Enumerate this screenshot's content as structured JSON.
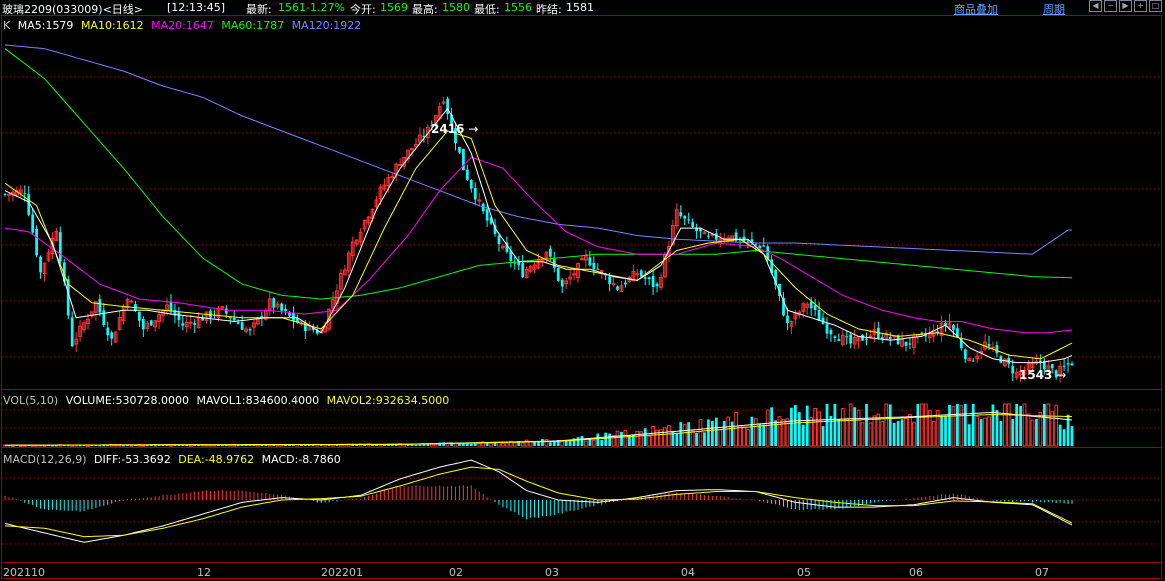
{
  "header": {
    "symbol": "玻璃2209(033009)<日线>",
    "time": "[12:13:45]",
    "latest_label": "最新:",
    "latest": "1561",
    "change": "-1.27%",
    "open_label": "今开:",
    "open": "1569",
    "high_label": "最高:",
    "high": "1580",
    "low_label": "最低:",
    "low": "1556",
    "prev_label": "昨结:",
    "prev": "1581",
    "overlay_btn": "商品叠加",
    "period_btn": "周期"
  },
  "ma_legend": {
    "k": "K",
    "ma5": "MA5:1579",
    "ma10": "MA10:1612",
    "ma20": "MA20:1647",
    "ma60": "MA60:1787",
    "ma120": "MA120:1922"
  },
  "vol_legend": {
    "title": "VOL(5,10)",
    "volume": "VOLUME:530728.0000",
    "mavol1": "MAVOL1:834600.4000",
    "mavol2": "MAVOL2:932634.5000"
  },
  "macd_legend": {
    "title": "MACD(12,26,9)",
    "diff": "DIFF:-53.3692",
    "dea": "DEA:-48.9762",
    "macd": "MACD:-8.7860"
  },
  "annotations": {
    "high_mark": "2416",
    "low_mark": "1543"
  },
  "x_axis": [
    "202110",
    "12",
    "202201",
    "02",
    "03",
    "04",
    "05",
    "06",
    "07"
  ],
  "colors": {
    "up": "#ff3232",
    "down": "#00ffff",
    "ma5": "#ffffff",
    "ma10": "#ffff00",
    "ma20": "#ff00ff",
    "ma60": "#00ff00",
    "ma120": "#8080ff",
    "grid": "#a00000"
  },
  "chart_data": {
    "type": "candlestick",
    "y_range": [
      1500,
      2450
    ],
    "series_keypoints": {
      "close": [
        [
          0,
          2010
        ],
        [
          5,
          2020
        ],
        [
          9,
          1800
        ],
        [
          13,
          1920
        ],
        [
          17,
          1610
        ],
        [
          23,
          1720
        ],
        [
          27,
          1620
        ],
        [
          31,
          1740
        ],
        [
          35,
          1650
        ],
        [
          41,
          1710
        ],
        [
          45,
          1660
        ],
        [
          55,
          1700
        ],
        [
          62,
          1640
        ],
        [
          67,
          1720
        ],
        [
          75,
          1660
        ],
        [
          80,
          1640
        ],
        [
          88,
          1880
        ],
        [
          95,
          2020
        ],
        [
          100,
          2100
        ],
        [
          107,
          2180
        ],
        [
          111,
          2270
        ],
        [
          116,
          2080
        ],
        [
          121,
          1960
        ],
        [
          126,
          1860
        ],
        [
          131,
          1800
        ],
        [
          137,
          1860
        ],
        [
          141,
          1760
        ],
        [
          147,
          1840
        ],
        [
          151,
          1800
        ],
        [
          155,
          1760
        ],
        [
          160,
          1800
        ],
        [
          165,
          1760
        ],
        [
          170,
          1960
        ],
        [
          174,
          1920
        ],
        [
          178,
          1890
        ],
        [
          183,
          1900
        ],
        [
          188,
          1880
        ],
        [
          192,
          1870
        ],
        [
          198,
          1660
        ],
        [
          203,
          1720
        ],
        [
          208,
          1650
        ],
        [
          214,
          1610
        ],
        [
          220,
          1640
        ],
        [
          228,
          1610
        ],
        [
          235,
          1640
        ],
        [
          239,
          1670
        ],
        [
          244,
          1560
        ],
        [
          248,
          1610
        ],
        [
          256,
          1530
        ],
        [
          262,
          1560
        ],
        [
          266,
          1530
        ],
        [
          270,
          1561
        ]
      ],
      "ma5": [
        [
          0,
          2020
        ],
        [
          6,
          1990
        ],
        [
          12,
          1880
        ],
        [
          18,
          1680
        ],
        [
          24,
          1690
        ],
        [
          30,
          1700
        ],
        [
          36,
          1700
        ],
        [
          42,
          1690
        ],
        [
          50,
          1680
        ],
        [
          58,
          1670
        ],
        [
          66,
          1680
        ],
        [
          74,
          1680
        ],
        [
          80,
          1640
        ],
        [
          86,
          1760
        ],
        [
          94,
          1970
        ],
        [
          100,
          2080
        ],
        [
          106,
          2160
        ],
        [
          112,
          2240
        ],
        [
          118,
          2120
        ],
        [
          124,
          1920
        ],
        [
          130,
          1830
        ],
        [
          136,
          1830
        ],
        [
          142,
          1810
        ],
        [
          148,
          1810
        ],
        [
          154,
          1790
        ],
        [
          160,
          1780
        ],
        [
          166,
          1820
        ],
        [
          171,
          1920
        ],
        [
          176,
          1920
        ],
        [
          182,
          1890
        ],
        [
          188,
          1890
        ],
        [
          192,
          1850
        ],
        [
          198,
          1700
        ],
        [
          204,
          1680
        ],
        [
          210,
          1660
        ],
        [
          216,
          1630
        ],
        [
          224,
          1620
        ],
        [
          232,
          1630
        ],
        [
          238,
          1660
        ],
        [
          244,
          1600
        ],
        [
          250,
          1570
        ],
        [
          256,
          1560
        ],
        [
          262,
          1560
        ],
        [
          268,
          1570
        ],
        [
          270,
          1579
        ]
      ],
      "ma10": [
        [
          0,
          2040
        ],
        [
          8,
          1980
        ],
        [
          16,
          1770
        ],
        [
          22,
          1720
        ],
        [
          30,
          1710
        ],
        [
          40,
          1700
        ],
        [
          50,
          1690
        ],
        [
          60,
          1680
        ],
        [
          70,
          1680
        ],
        [
          80,
          1650
        ],
        [
          88,
          1740
        ],
        [
          96,
          1920
        ],
        [
          104,
          2080
        ],
        [
          112,
          2180
        ],
        [
          118,
          2160
        ],
        [
          124,
          1980
        ],
        [
          132,
          1860
        ],
        [
          140,
          1820
        ],
        [
          150,
          1800
        ],
        [
          160,
          1780
        ],
        [
          170,
          1860
        ],
        [
          178,
          1880
        ],
        [
          186,
          1890
        ],
        [
          192,
          1850
        ],
        [
          200,
          1760
        ],
        [
          208,
          1690
        ],
        [
          216,
          1650
        ],
        [
          226,
          1630
        ],
        [
          236,
          1640
        ],
        [
          244,
          1620
        ],
        [
          254,
          1580
        ],
        [
          262,
          1570
        ],
        [
          270,
          1612
        ]
      ],
      "ma20": [
        [
          0,
          1920
        ],
        [
          6,
          1910
        ],
        [
          14,
          1850
        ],
        [
          24,
          1770
        ],
        [
          34,
          1730
        ],
        [
          44,
          1720
        ],
        [
          56,
          1700
        ],
        [
          66,
          1700
        ],
        [
          76,
          1690
        ],
        [
          84,
          1700
        ],
        [
          92,
          1780
        ],
        [
          102,
          1900
        ],
        [
          110,
          2020
        ],
        [
          118,
          2110
        ],
        [
          126,
          2080
        ],
        [
          134,
          1990
        ],
        [
          142,
          1910
        ],
        [
          150,
          1870
        ],
        [
          160,
          1850
        ],
        [
          170,
          1850
        ],
        [
          180,
          1880
        ],
        [
          190,
          1870
        ],
        [
          196,
          1840
        ],
        [
          204,
          1790
        ],
        [
          212,
          1740
        ],
        [
          222,
          1700
        ],
        [
          230,
          1680
        ],
        [
          236,
          1670
        ],
        [
          242,
          1670
        ],
        [
          250,
          1650
        ],
        [
          258,
          1640
        ],
        [
          264,
          1640
        ],
        [
          270,
          1647
        ]
      ],
      "ma60": [
        [
          0,
          2400
        ],
        [
          10,
          2320
        ],
        [
          20,
          2200
        ],
        [
          30,
          2080
        ],
        [
          40,
          1950
        ],
        [
          50,
          1840
        ],
        [
          60,
          1770
        ],
        [
          70,
          1740
        ],
        [
          80,
          1730
        ],
        [
          90,
          1740
        ],
        [
          100,
          1760
        ],
        [
          110,
          1790
        ],
        [
          120,
          1820
        ],
        [
          130,
          1830
        ],
        [
          140,
          1840
        ],
        [
          150,
          1850
        ],
        [
          160,
          1850
        ],
        [
          170,
          1850
        ],
        [
          180,
          1850
        ],
        [
          190,
          1860
        ],
        [
          200,
          1850
        ],
        [
          210,
          1840
        ],
        [
          220,
          1830
        ],
        [
          230,
          1820
        ],
        [
          240,
          1810
        ],
        [
          250,
          1800
        ],
        [
          260,
          1790
        ],
        [
          270,
          1787
        ]
      ],
      "ma120": [
        [
          0,
          2410
        ],
        [
          10,
          2400
        ],
        [
          20,
          2370
        ],
        [
          30,
          2340
        ],
        [
          40,
          2300
        ],
        [
          50,
          2270
        ],
        [
          60,
          2220
        ],
        [
          70,
          2180
        ],
        [
          80,
          2140
        ],
        [
          90,
          2100
        ],
        [
          100,
          2060
        ],
        [
          110,
          2020
        ],
        [
          120,
          1980
        ],
        [
          130,
          1950
        ],
        [
          140,
          1930
        ],
        [
          150,
          1920
        ],
        [
          160,
          1900
        ],
        [
          170,
          1890
        ],
        [
          180,
          1885
        ],
        [
          190,
          1880
        ],
        [
          200,
          1880
        ],
        [
          210,
          1875
        ],
        [
          220,
          1870
        ],
        [
          230,
          1865
        ],
        [
          240,
          1860
        ],
        [
          250,
          1855
        ],
        [
          260,
          1850
        ],
        [
          270,
          1922
        ]
      ]
    },
    "volume_keypoints": [
      [
        0,
        0.02
      ],
      [
        60,
        0.03
      ],
      [
        100,
        0.04
      ],
      [
        120,
        0.08
      ],
      [
        140,
        0.13
      ],
      [
        160,
        0.3
      ],
      [
        180,
        0.55
      ],
      [
        200,
        0.75
      ],
      [
        220,
        0.8
      ],
      [
        240,
        0.85
      ],
      [
        255,
        0.9
      ],
      [
        265,
        0.75
      ],
      [
        270,
        0.55
      ]
    ],
    "mavol_keypoints": {
      "mavol1": [
        [
          0,
          0.02
        ],
        [
          100,
          0.04
        ],
        [
          140,
          0.12
        ],
        [
          170,
          0.35
        ],
        [
          200,
          0.6
        ],
        [
          230,
          0.7
        ],
        [
          250,
          0.8
        ],
        [
          270,
          0.62
        ]
      ],
      "mavol2": [
        [
          0,
          0.02
        ],
        [
          100,
          0.04
        ],
        [
          140,
          0.11
        ],
        [
          170,
          0.3
        ],
        [
          200,
          0.55
        ],
        [
          230,
          0.68
        ],
        [
          250,
          0.75
        ],
        [
          270,
          0.7
        ]
      ]
    },
    "macd_keypoints": {
      "diff": [
        [
          0,
          -50
        ],
        [
          10,
          -70
        ],
        [
          20,
          -90
        ],
        [
          30,
          -75
        ],
        [
          40,
          -55
        ],
        [
          50,
          -30
        ],
        [
          60,
          -5
        ],
        [
          70,
          5
        ],
        [
          80,
          0
        ],
        [
          90,
          10
        ],
        [
          100,
          45
        ],
        [
          110,
          70
        ],
        [
          118,
          85
        ],
        [
          125,
          60
        ],
        [
          132,
          20
        ],
        [
          140,
          0
        ],
        [
          150,
          -5
        ],
        [
          160,
          5
        ],
        [
          170,
          20
        ],
        [
          180,
          22
        ],
        [
          190,
          18
        ],
        [
          200,
          -5
        ],
        [
          210,
          -15
        ],
        [
          220,
          -15
        ],
        [
          230,
          -10
        ],
        [
          240,
          5
        ],
        [
          250,
          -5
        ],
        [
          260,
          -10
        ],
        [
          270,
          -53
        ]
      ],
      "dea": [
        [
          0,
          -55
        ],
        [
          10,
          -60
        ],
        [
          20,
          -78
        ],
        [
          30,
          -75
        ],
        [
          40,
          -60
        ],
        [
          50,
          -40
        ],
        [
          60,
          -15
        ],
        [
          70,
          0
        ],
        [
          80,
          3
        ],
        [
          90,
          8
        ],
        [
          100,
          30
        ],
        [
          110,
          55
        ],
        [
          118,
          70
        ],
        [
          125,
          65
        ],
        [
          132,
          40
        ],
        [
          140,
          15
        ],
        [
          150,
          0
        ],
        [
          160,
          2
        ],
        [
          170,
          12
        ],
        [
          180,
          18
        ],
        [
          190,
          18
        ],
        [
          200,
          5
        ],
        [
          210,
          -5
        ],
        [
          220,
          -12
        ],
        [
          230,
          -12
        ],
        [
          240,
          -2
        ],
        [
          250,
          -4
        ],
        [
          260,
          -8
        ],
        [
          270,
          -49
        ]
      ]
    }
  }
}
